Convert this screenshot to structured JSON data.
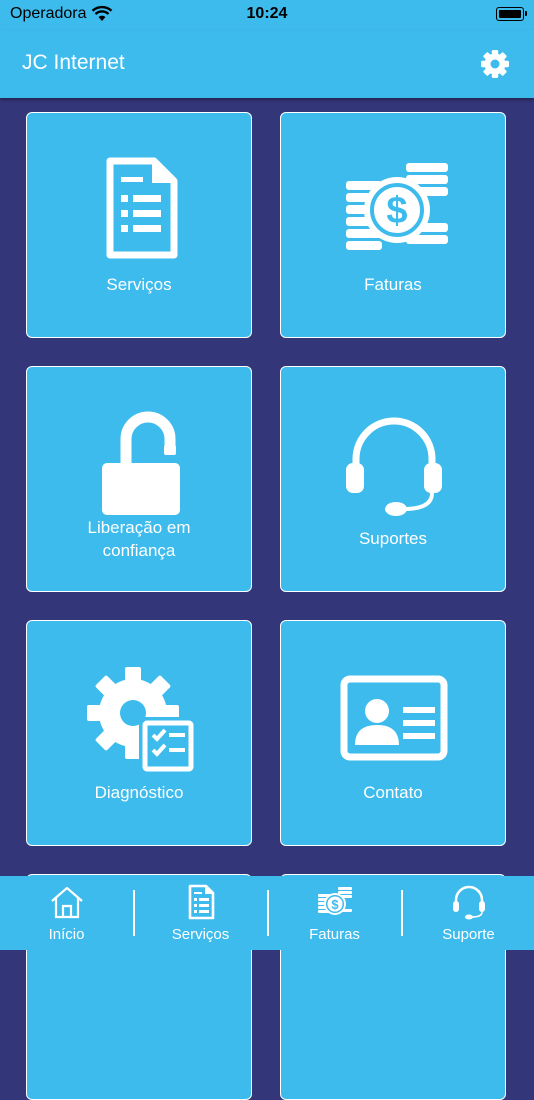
{
  "status_bar": {
    "carrier": "Operadora",
    "time": "10:24"
  },
  "header": {
    "title": "JC Internet",
    "settings_icon": "gear-icon"
  },
  "tiles": [
    {
      "label": "Serviços",
      "icon": "document-list-icon"
    },
    {
      "label": "Faturas",
      "icon": "coins-dollar-icon"
    },
    {
      "label": "Liberação em",
      "label2": "confiança",
      "icon": "unlocked-padlock-icon"
    },
    {
      "label": "Suportes",
      "icon": "headset-icon"
    },
    {
      "label": "Diagnóstico",
      "icon": "gear-checklist-icon"
    },
    {
      "label": "Contato",
      "icon": "contact-card-icon"
    }
  ],
  "tabbar": {
    "items": [
      {
        "label": "Início",
        "icon": "home-icon"
      },
      {
        "label": "Serviços",
        "icon": "document-list-icon"
      },
      {
        "label": "Faturas",
        "icon": "coins-dollar-icon"
      },
      {
        "label": "Suporte",
        "icon": "headset-icon"
      }
    ]
  },
  "colors": {
    "primary": "#3dbbed",
    "background": "#34367a",
    "foreground": "#ffffff"
  }
}
